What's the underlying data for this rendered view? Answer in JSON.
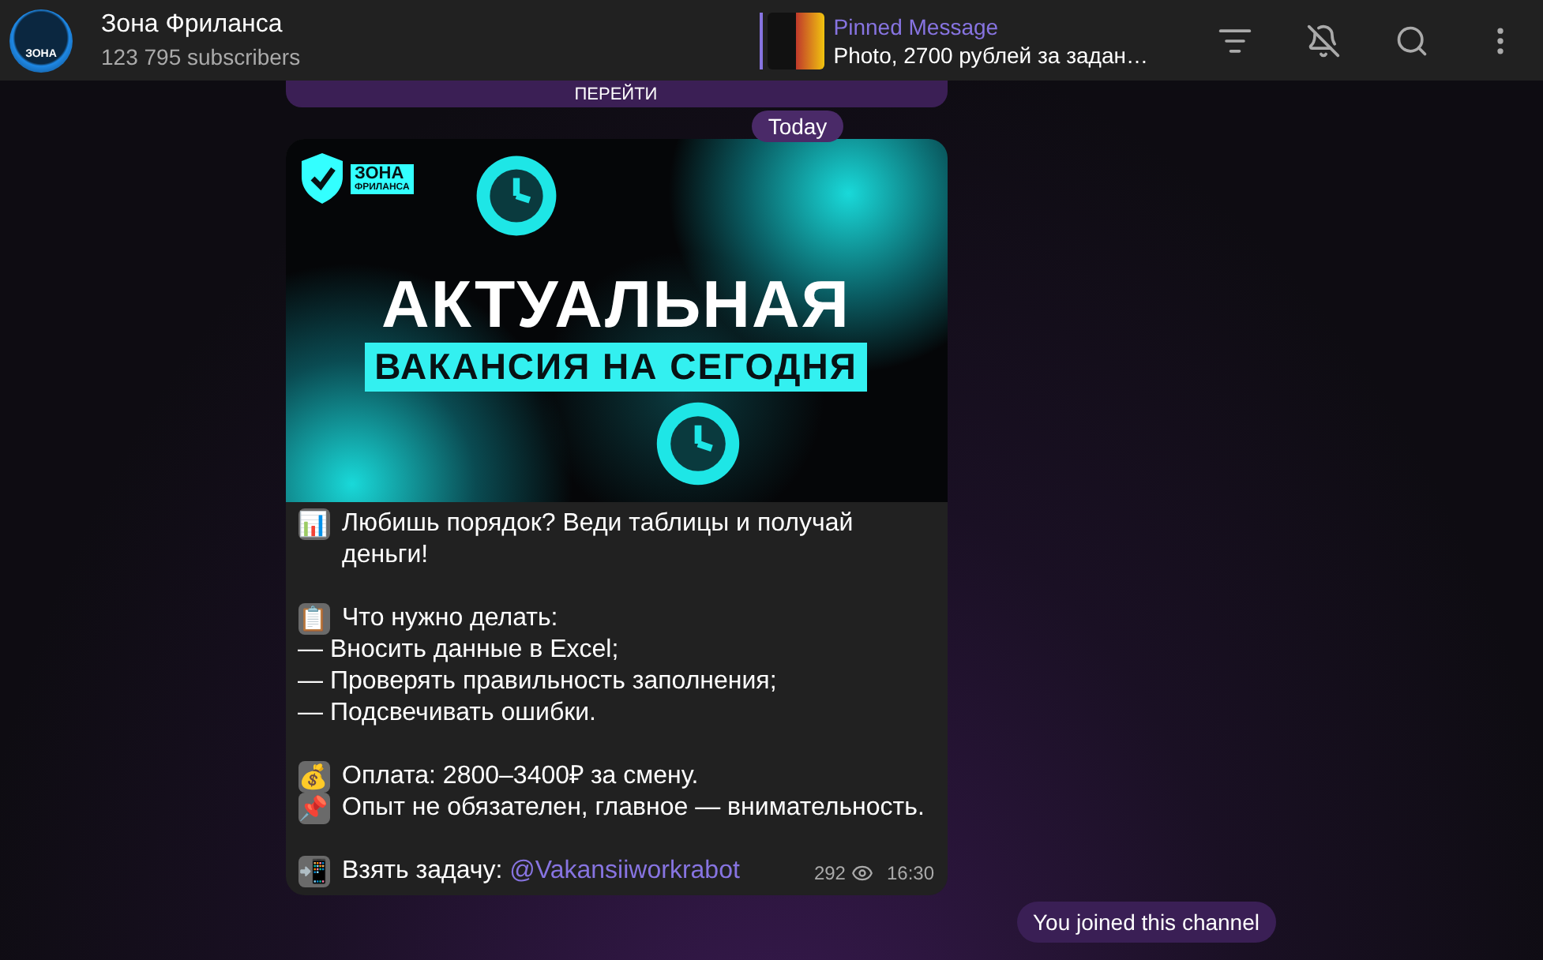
{
  "header": {
    "channel_name": "Зона Фриланса",
    "subscribers": "123 795 subscribers",
    "avatar_text": "ЗОНА",
    "pinned": {
      "title": "Pinned Message",
      "text": "Photo, 2700 рублей за задан…"
    }
  },
  "previous_message": {
    "button": "ПЕРЕЙТИ"
  },
  "date_badge": "Today",
  "post": {
    "banner": {
      "logo_top": "ЗОНА",
      "logo_bottom": "ФРИЛАНСА",
      "headline": "АКТУАЛЬНАЯ",
      "subheadline": "ВАКАНСИЯ НА СЕГОДНЯ"
    },
    "paragraphs": [
      [
        {
          "emoji": "📊",
          "text": "Любишь порядок? Веди таблицы и получай деньги!"
        }
      ],
      [
        {
          "emoji": "📋",
          "text": "Что нужно делать:"
        },
        {
          "text": "— Вносить данные в Excel;"
        },
        {
          "text": "— Проверять правильность заполнения;"
        },
        {
          "text": "— Подсвечивать ошибки."
        }
      ],
      [
        {
          "emoji": "💰",
          "text": "Оплата: 2800–3400₽ за смену."
        },
        {
          "emoji": "📌",
          "text": "Опыт не обязателен, главное — внимательность."
        }
      ],
      [
        {
          "emoji": "📲",
          "text": "Взять задачу: ",
          "link": "@Vakansiiworkrabot"
        }
      ]
    ],
    "views": "292",
    "time": "16:30"
  },
  "service_message": "You joined this channel"
}
